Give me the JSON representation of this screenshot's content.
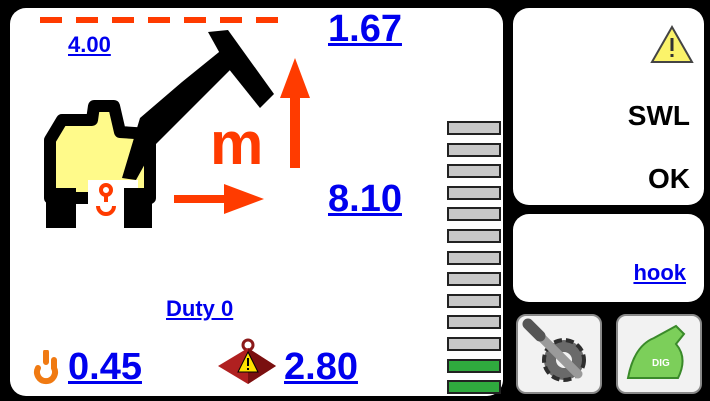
{
  "readouts": {
    "height_limit": "4.00",
    "height": "1.67",
    "radius": "8.10",
    "duty": "Duty 0",
    "hook_load": "0.45",
    "swl": "2.80"
  },
  "units": {
    "meter": "m"
  },
  "alarm": {
    "line1": "SWL",
    "line2": "OK"
  },
  "hook_panel": {
    "label": "hook"
  },
  "load_bar": {
    "total": 13,
    "lit": 2
  },
  "colors": {
    "accent": "#ff3b00",
    "link": "#0000ee",
    "machine": "#fffa8a",
    "bar_ok": "#2faa3e",
    "bar_off": "#c8c8c8"
  },
  "icons": {
    "warning": "warning-triangle-icon",
    "settings": "settings-gear-icon",
    "dig": "dig-mode-icon",
    "hook": "hook-icon",
    "weight": "weight-alert-icon"
  }
}
